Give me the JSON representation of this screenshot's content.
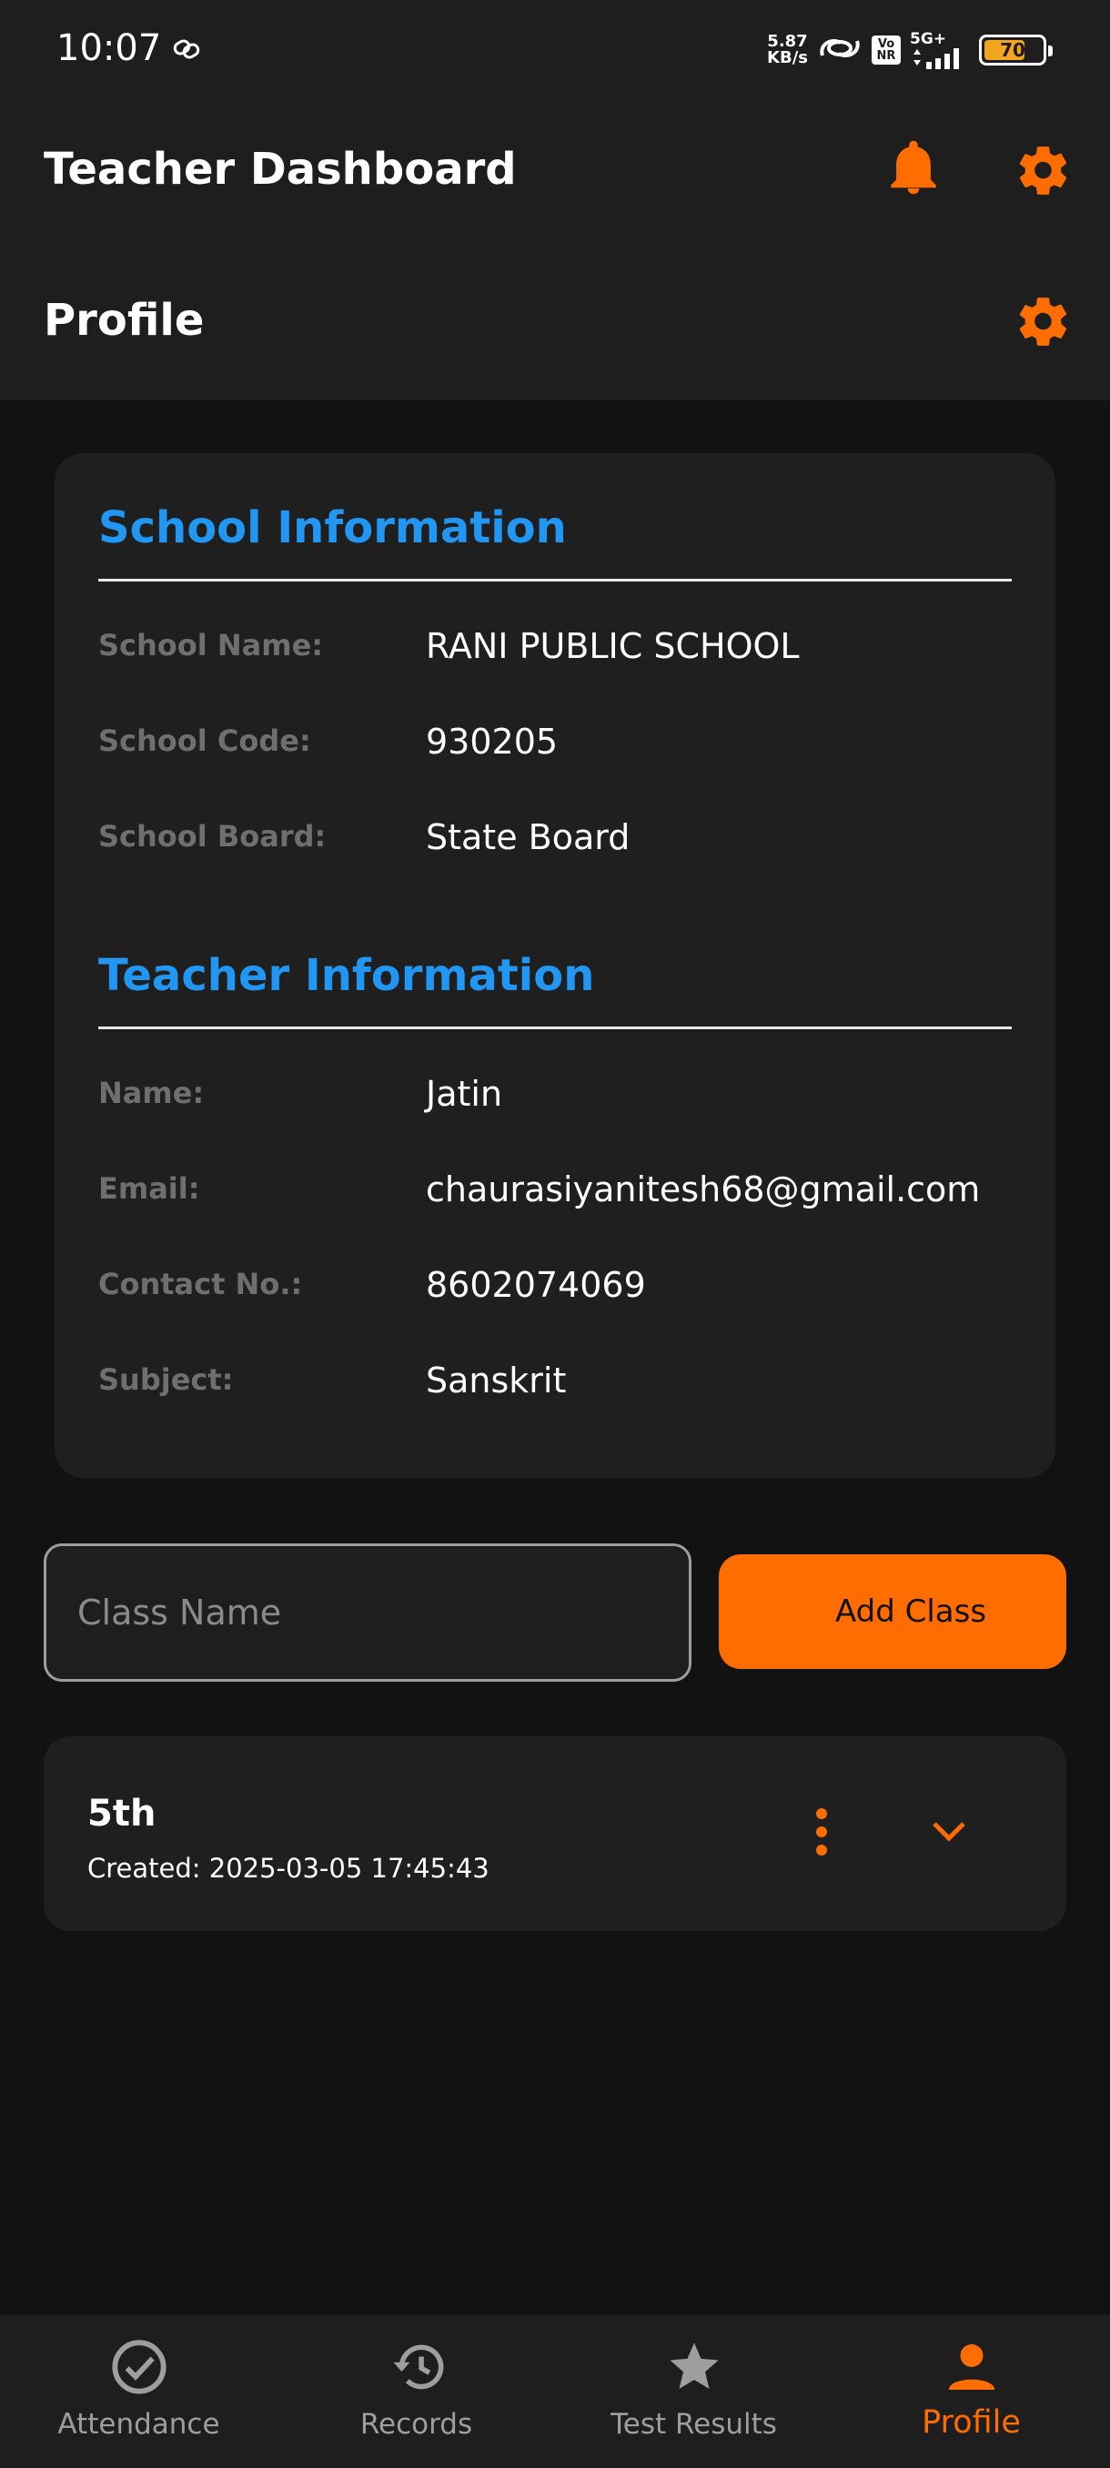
{
  "status_bar": {
    "time": "10:07",
    "net_speed_value": "5.87",
    "net_speed_unit": "KB/s",
    "network": "5G+",
    "volte": "Vo NR",
    "battery": "70"
  },
  "appbar": {
    "title": "Teacher Dashboard",
    "page_title": "Profile"
  },
  "school_info": {
    "title": "School Information",
    "rows": [
      {
        "label": "School Name:",
        "value": "RANI PUBLIC SCHOOL"
      },
      {
        "label": "School Code:",
        "value": "930205"
      },
      {
        "label": "School Board:",
        "value": "State Board"
      }
    ]
  },
  "teacher_info": {
    "title": "Teacher Information",
    "rows": [
      {
        "label": "Name:",
        "value": "Jatin"
      },
      {
        "label": "Email:",
        "value": "chaurasiyanitesh68@gmail.com"
      },
      {
        "label": "Contact No.:",
        "value": "8602074069"
      },
      {
        "label": "Subject:",
        "value": "Sanskrit"
      }
    ]
  },
  "add_class": {
    "placeholder": "Class Name",
    "value": "",
    "button_label": "Add Class"
  },
  "classes": [
    {
      "name": "5th",
      "created": "Created: 2025-03-05 17:45:43"
    }
  ],
  "bottom_nav": {
    "items": [
      {
        "label": "Attendance",
        "icon": "check-circle-icon",
        "active": false
      },
      {
        "label": "Records",
        "icon": "history-icon",
        "active": false
      },
      {
        "label": "Test Results",
        "icon": "star-icon",
        "active": false
      },
      {
        "label": "Profile",
        "icon": "person-icon",
        "active": true
      }
    ]
  },
  "colors": {
    "accent": "#ff6d00",
    "section_title": "#2196f3",
    "background": "#121212",
    "surface": "#1e1e1e",
    "inactive": "#9e9e9e"
  }
}
